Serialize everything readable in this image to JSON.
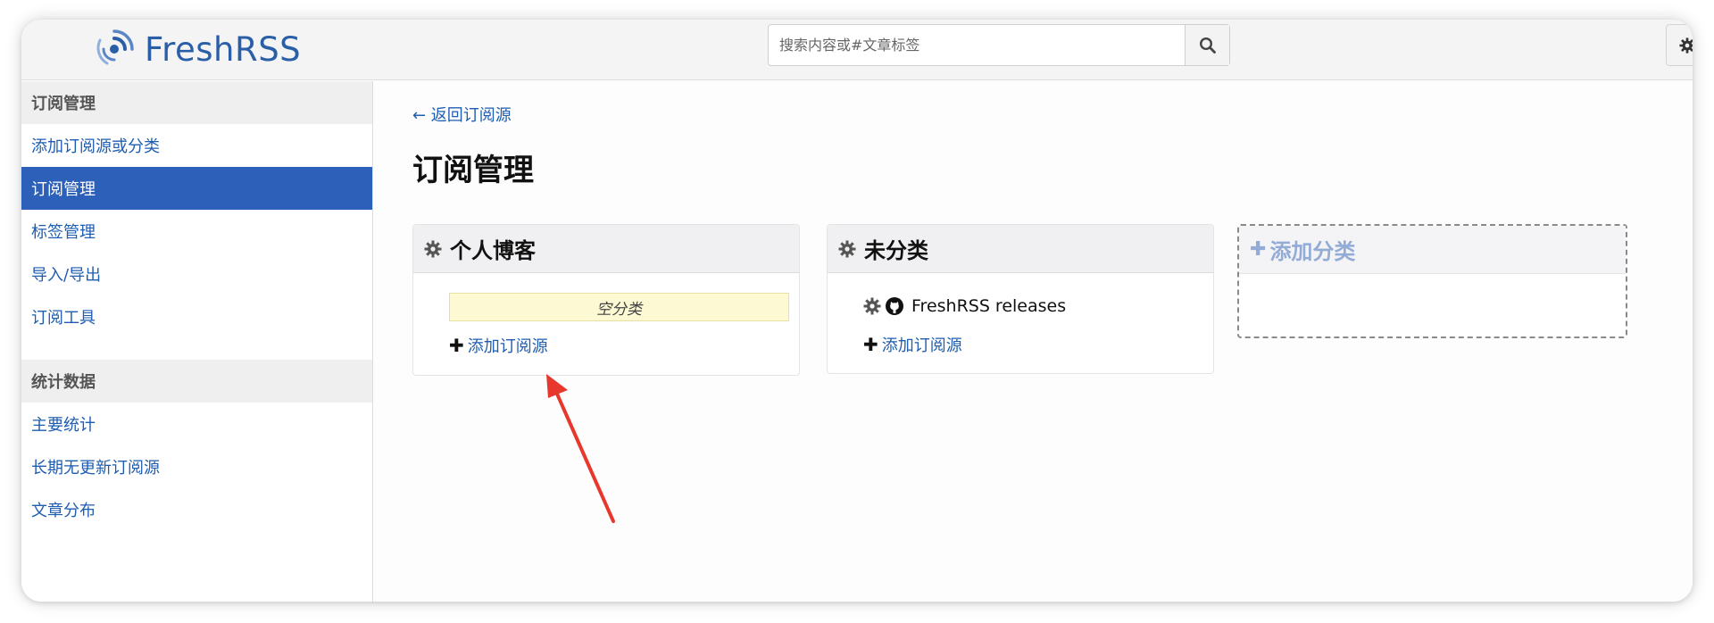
{
  "app": {
    "name": "FreshRSS",
    "brand_color": "#2a5fa8",
    "accent_color": "#2d60b8",
    "link_color": "#1f5db0"
  },
  "search": {
    "placeholder": "搜索内容或#文章标签",
    "button_icon": "search-icon"
  },
  "header": {
    "settings_icon": "gear-icon"
  },
  "sidebar": {
    "sections": [
      {
        "title": "订阅管理",
        "items": [
          {
            "label": "添加订阅源或分类",
            "active": false
          },
          {
            "label": "订阅管理",
            "active": true
          },
          {
            "label": "标签管理",
            "active": false
          },
          {
            "label": "导入/导出",
            "active": false
          },
          {
            "label": "订阅工具",
            "active": false
          }
        ]
      },
      {
        "title": "统计数据",
        "items": [
          {
            "label": "主要统计",
            "active": false
          },
          {
            "label": "长期无更新订阅源",
            "active": false
          },
          {
            "label": "文章分布",
            "active": false
          }
        ]
      }
    ]
  },
  "main": {
    "back_link": "← 返回订阅源",
    "title": "订阅管理",
    "categories": [
      {
        "name": "个人博客",
        "empty_label": "空分类",
        "feeds": [],
        "add_feed_label": "添加订阅源"
      },
      {
        "name": "未分类",
        "empty_label": "",
        "feeds": [
          {
            "name": "FreshRSS releases",
            "icon": "github-icon"
          }
        ],
        "add_feed_label": "添加订阅源"
      }
    ],
    "add_category_label": "添加分类"
  },
  "annotation": {
    "arrow_color": "#e8372c"
  }
}
